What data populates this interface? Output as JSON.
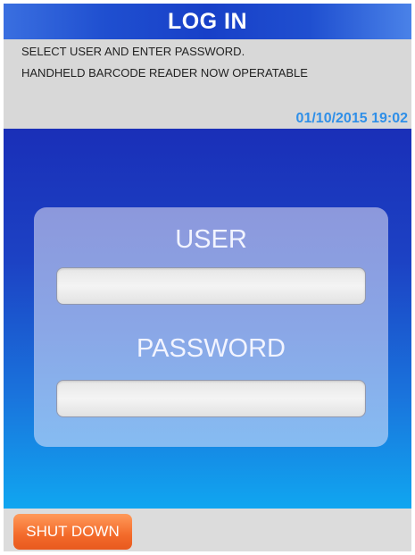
{
  "header": {
    "title": "LOG IN"
  },
  "info": {
    "line1": "SELECT USER AND ENTER PASSWORD.",
    "line2": "HANDHELD BARCODE READER NOW OPERATABLE",
    "datetime": "01/10/2015 19:02"
  },
  "login": {
    "user_label": "USER",
    "user_value": "",
    "password_label": "PASSWORD",
    "password_value": ""
  },
  "footer": {
    "shutdown_label": "SHUT DOWN"
  },
  "colors": {
    "title_bar": "#1f4fd0",
    "datetime_text": "#2f8fe8",
    "shutdown_button": "#f36a2a"
  }
}
